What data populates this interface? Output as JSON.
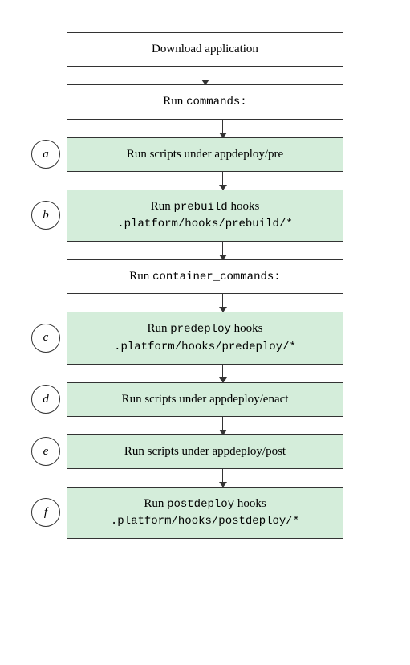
{
  "nodes": [
    {
      "id": "download",
      "label": null,
      "text": "Download application",
      "green": false,
      "hasCode": false
    },
    {
      "id": "run-commands",
      "label": null,
      "text_parts": [
        {
          "type": "normal",
          "val": "Run "
        },
        {
          "type": "code",
          "val": "commands:"
        }
      ],
      "green": false,
      "hasCode": true
    },
    {
      "id": "a",
      "label": "a",
      "text": "Run scripts under appdeploy/pre",
      "green": true,
      "hasCode": false
    },
    {
      "id": "b",
      "label": "b",
      "line1_parts": [
        {
          "type": "normal",
          "val": "Run "
        },
        {
          "type": "code",
          "val": "prebuild"
        },
        {
          "type": "normal",
          "val": " hooks"
        }
      ],
      "line2": ".platform/hooks/prebuild/*",
      "line2code": true,
      "green": true,
      "multiline": true
    },
    {
      "id": "run-container",
      "label": null,
      "text_parts": [
        {
          "type": "normal",
          "val": "Run "
        },
        {
          "type": "code",
          "val": "container_commands:"
        }
      ],
      "green": false,
      "hasCode": true
    },
    {
      "id": "c",
      "label": "c",
      "line1_parts": [
        {
          "type": "normal",
          "val": "Run "
        },
        {
          "type": "code",
          "val": "predeploy"
        },
        {
          "type": "normal",
          "val": " hooks"
        }
      ],
      "line2": ".platform/hooks/predeploy/*",
      "line2code": true,
      "green": true,
      "multiline": true
    },
    {
      "id": "d",
      "label": "d",
      "text": "Run scripts under appdeploy/enact",
      "green": true,
      "hasCode": false
    },
    {
      "id": "e",
      "label": "e",
      "text": "Run scripts under appdeploy/post",
      "green": true,
      "hasCode": false
    },
    {
      "id": "f",
      "label": "f",
      "line1_parts": [
        {
          "type": "normal",
          "val": "Run "
        },
        {
          "type": "code",
          "val": "postdeploy"
        },
        {
          "type": "normal",
          "val": " hooks"
        }
      ],
      "line2": ".platform/hooks/postdeploy/*",
      "line2code": true,
      "green": true,
      "multiline": true
    }
  ]
}
